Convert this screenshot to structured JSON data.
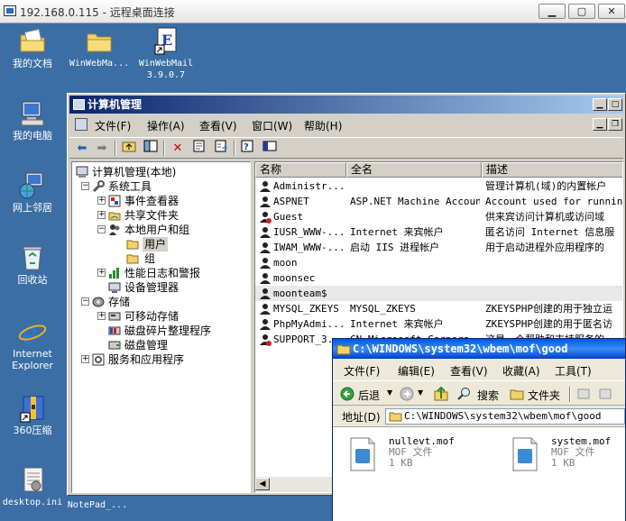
{
  "remote": {
    "title": "192.168.0.115 - 远程桌面连接",
    "btn_minimize": "▁",
    "btn_restore": "▢",
    "btn_close": "✕"
  },
  "desktop": {
    "icons": [
      {
        "label": "我的文档"
      },
      {
        "label": "WinWebMa..."
      },
      {
        "label": "WinWebMail\n3.9.0.7"
      },
      {
        "label": "我的电脑"
      },
      {
        "label": "网上邻居"
      },
      {
        "label": "回收站"
      },
      {
        "label": "Internet\nExplorer"
      },
      {
        "label": "360压缩"
      },
      {
        "label": "desktop.ini"
      },
      {
        "label": "NotePad_..."
      }
    ]
  },
  "computer_mgmt": {
    "title": "计算机管理",
    "menu": [
      "文件(F)",
      "操作(A)",
      "查看(V)",
      "窗口(W)",
      "帮助(H)"
    ],
    "tree": [
      {
        "label": "计算机管理(本地)"
      },
      {
        "label": "系统工具"
      },
      {
        "label": "事件查看器"
      },
      {
        "label": "共享文件夹"
      },
      {
        "label": "本地用户和组"
      },
      {
        "label": "用户"
      },
      {
        "label": "组"
      },
      {
        "label": "性能日志和警报"
      },
      {
        "label": "设备管理器"
      },
      {
        "label": "存储"
      },
      {
        "label": "可移动存储"
      },
      {
        "label": "磁盘碎片整理程序"
      },
      {
        "label": "磁盘管理"
      },
      {
        "label": "服务和应用程序"
      }
    ],
    "columns": [
      "名称",
      "全名",
      "描述"
    ],
    "users": [
      {
        "name": "Administr...",
        "full": "",
        "desc": "管理计算机(域)的内置帐户"
      },
      {
        "name": "ASPNET",
        "full": "ASP.NET Machine Account",
        "desc": "Account used for running"
      },
      {
        "name": "Guest",
        "full": "",
        "desc": "供来宾访问计算机或访问域"
      },
      {
        "name": "IUSR_WWW-...",
        "full": "Internet 来宾帐户",
        "desc": "匿名访问 Internet 信息服"
      },
      {
        "name": "IWAM_WWW-...",
        "full": "启动 IIS 进程帐户",
        "desc": "用于启动进程外应用程序的"
      },
      {
        "name": "moon",
        "full": "",
        "desc": ""
      },
      {
        "name": "moonsec",
        "full": "",
        "desc": ""
      },
      {
        "name": "moonteam$",
        "full": "",
        "desc": ""
      },
      {
        "name": "MYSQL_ZKEYS",
        "full": "MYSQL_ZKEYS",
        "desc": "ZKEYSPHP创建的用于独立运"
      },
      {
        "name": "PhpMyAdmi...",
        "full": "Internet 来宾帐户",
        "desc": "ZKEYSPHP创建的用于匿名访"
      },
      {
        "name": "SUPPORT_3...",
        "full": "CN=Microsoft Corpora...",
        "desc": "这是一个帮助和支持服务的"
      }
    ]
  },
  "explorer": {
    "title": "C:\\WINDOWS\\system32\\wbem\\mof\\good",
    "menu": [
      "文件(F)",
      "编辑(E)",
      "查看(V)",
      "收藏(A)",
      "工具(T)"
    ],
    "back_label": "后退",
    "search_label": "搜索",
    "folders_label": "文件夹",
    "address_label": "地址(D)",
    "address": "C:\\WINDOWS\\system32\\wbem\\mof\\good",
    "files": [
      {
        "name": "nullevt.mof",
        "type": "MOF 文件",
        "size": "1 KB"
      },
      {
        "name": "system.mof",
        "type": "MOF 文件",
        "size": "1 KB"
      }
    ]
  }
}
